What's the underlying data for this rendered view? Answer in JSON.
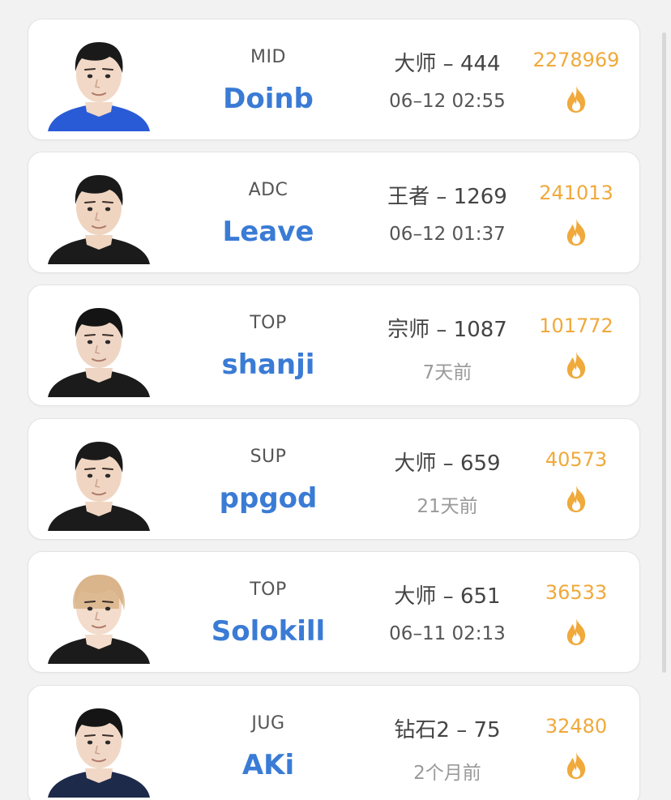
{
  "players": [
    {
      "role": "MID",
      "name": "Doinb",
      "rank": "大师 – 444",
      "time": "06–12 02:55",
      "time_faded": false,
      "heat": "2278969",
      "jersey": "#2a5bd7",
      "hair": "#1a1a1a",
      "skin": "#f2d8c6"
    },
    {
      "role": "ADC",
      "name": "Leave",
      "rank": "王者 – 1269",
      "time": "06–12 01:37",
      "time_faded": false,
      "heat": "241013",
      "jersey": "#1b1b1b",
      "hair": "#1a1a1a",
      "skin": "#efd4c0"
    },
    {
      "role": "TOP",
      "name": "shanji",
      "rank": "宗师 – 1087",
      "time": "7天前",
      "time_faded": true,
      "heat": "101772",
      "jersey": "#1b1b1b",
      "hair": "#141414",
      "skin": "#efd6c4"
    },
    {
      "role": "SUP",
      "name": "ppgod",
      "rank": "大师 – 659",
      "time": "21天前",
      "time_faded": true,
      "heat": "40573",
      "jersey": "#1b1b1b",
      "hair": "#1a1a1a",
      "skin": "#f0d6c2"
    },
    {
      "role": "TOP",
      "name": "Solokill",
      "rank": "大师 – 651",
      "time": "06–11 02:13",
      "time_faded": false,
      "heat": "36533",
      "jersey": "#1b1b1b",
      "hair": "#d9b48a",
      "skin": "#f3dccb"
    },
    {
      "role": "JUG",
      "name": "AKi",
      "rank": "钻石2 – 75",
      "time": "2个月前",
      "time_faded": true,
      "heat": "32480",
      "jersey": "#1e2a4a",
      "hair": "#151515",
      "skin": "#f1d8c6"
    }
  ],
  "icons": {
    "heat": "fire-icon"
  },
  "colors": {
    "name": "#3a7bd5",
    "heat": "#f0a93b",
    "card_bg": "#ffffff",
    "page_bg": "#f2f2f2"
  }
}
